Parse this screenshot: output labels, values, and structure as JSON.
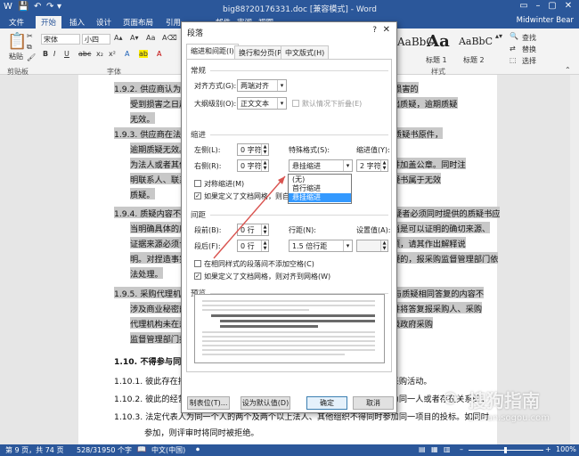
{
  "window": {
    "title": "big88?20176331.doc [兼容模式] - Word",
    "user": "Midwinter Bear"
  },
  "ribbon": {
    "tabs": [
      "文件",
      "开始",
      "插入",
      "设计",
      "页面布局",
      "引用",
      "邮件",
      "审阅",
      "视图"
    ],
    "paste": "粘贴",
    "clipboard": "剪贴板",
    "font_name": "宋体",
    "font_size": "小四",
    "font_group": "字体",
    "styles_group": "样式",
    "style1_glyph": "AaBbC",
    "style2_glyph": "Aa",
    "style3_glyph": "AaBbC",
    "style2_label": "标题 1",
    "style3_label": "标题 2",
    "find": "查找",
    "replace": "替换",
    "select": "选择"
  },
  "document": {
    "lines": [
      "1.9.2. 供应商认为采购文件、采购过程和中标或者成交结果使自己的权益受到损害的",
      "受到损害之日起七个工作日内，以书面形式向采购人或者采购代理机构提出质疑，逾期质疑",
      "无效。",
      "1.9.3. 供应商在法定质疑期内一次性提出针对同一采购程序环节的质疑并提交质疑书原件，",
      "逾期质疑无效。质疑供应商为自然人的，应当由本人签字；质疑供应商",
      "为法人或者其他组织的，应当由法定代表人、主要负责人签字或者盖章，并加盖公章。同时注",
      "明联系人、联系电话。质疑书中应包括质疑事项、依据等内容，提交的质疑书属于无效",
      "质疑。",
      "1.9.4. 质疑内容不得含有虚假、恶意成分。依照谁主张谁举证的原则，提出质疑者必须同时提供的质疑书应",
      "当明确具体的质疑事项和与质疑事项相关的请求，依法应当提供的证据应当是可以证明的确切来源、",
      "证据来源必须合法。质疑人应当在法定期限内提出，逾期质疑或者质疑事项，请其作出解释说",
      "明。对捏造事实、提供虚假材料或者以非法手段取得证明材料进行恶意质疑的，报采购监督管理部门依",
      "法处理。",
      "1.9.5. 采购代理机构不得泄露供应商提交的与质疑有关的信息，不得擅自回答与质疑相同答复的内容不",
      "涉及商业秘密的，采购代理机构应将质疑答复内容告知其他相关供应商，并将答复报采购人、采购",
      "代理机构未在规定时间内作出答复的，质疑供应商可以在答复期满后向同级政府采购",
      "监督管理部门投诉。",
      "1.10. 不得参与同一项目投标的情形",
      "1.10.1. 彼此存在控股、管理关系的不同单位，不得参加同一合同项下的政府采购活动。",
      "1.10.2. 彼此的经营者为同一人或者存在直接控股、管理关系的；单位负责人为同一人或者存在关系的；",
      "1.10.3. 法定代表人为同一个人的两个及两个以上法人、其他组织不得同时参加同一项目的投标。如同时",
      "参加，则评审时将同时被拒绝。"
    ]
  },
  "status": {
    "page": "第 9 页，共 74 页",
    "words": "528/31950 个字",
    "lang": "中文(中国)",
    "zoom": "100%"
  },
  "dialog": {
    "title": "段落",
    "help": "?",
    "close": "✕",
    "tabs": [
      "缩进和间距(I)",
      "换行和分页(P)",
      "中文版式(H)"
    ],
    "general": "常规",
    "align_label": "对齐方式(G):",
    "align_value": "两端对齐",
    "outline_label": "大纲级别(O):",
    "outline_value": "正文文本",
    "collapsed_label": "默认情况下折叠(E)",
    "indent": "缩进",
    "left_label": "左侧(L):",
    "left_value": "0 字符",
    "right_label": "右侧(R):",
    "right_value": "0 字符",
    "special_label": "特殊格式(S):",
    "special_value": "悬挂缩进",
    "by_label": "缩进值(Y):",
    "by_value": "2 字符",
    "mirror_label": "对称缩进(M)",
    "grid_indent_label": "如果定义了文档网格，则自动调整右缩进(D)",
    "special_options": [
      "(无)",
      "首行缩进",
      "悬挂缩进"
    ],
    "spacing": "间距",
    "before_label": "段前(B):",
    "before_value": "0 行",
    "after_label": "段后(F):",
    "after_value": "0 行",
    "linespacing_label": "行距(N):",
    "linespacing_value": "1.5 倍行距",
    "at_label": "设置值(A):",
    "at_value": "",
    "nospace_label": "在相同样式的段落间不添加空格(C)",
    "snapgrid_label": "如果定义了文档网格，则对齐到网格(W)",
    "preview": "预览",
    "tabs_button": "制表位(T)...",
    "default_button": "设为默认值(D)",
    "ok_button": "确定",
    "cancel_button": "取消"
  },
  "watermark": {
    "brand": "搜狗指南",
    "url": "zhinan.sogou.com"
  }
}
